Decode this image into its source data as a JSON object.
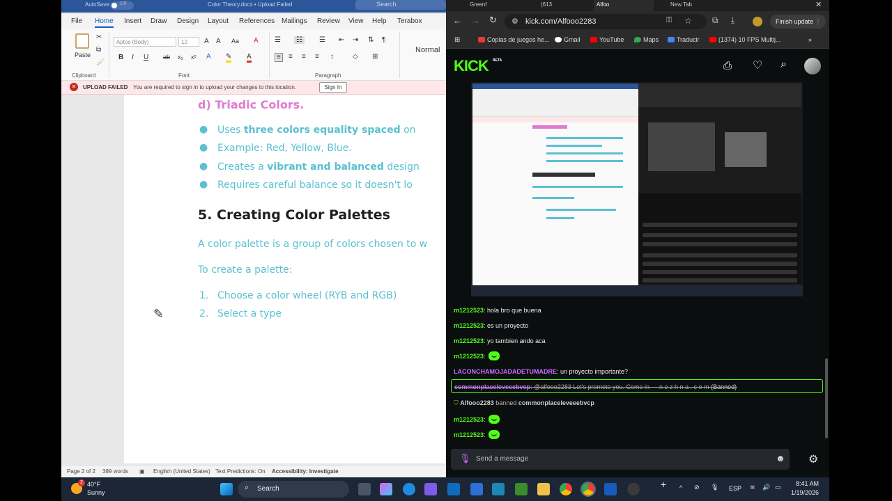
{
  "word": {
    "titlebar": {
      "autosave": "AutoSave",
      "toggle": "Off",
      "filename": "Color Theory.docx • Upload Failed",
      "search": "Search"
    },
    "tabs": [
      "File",
      "Home",
      "Insert",
      "Draw",
      "Design",
      "Layout",
      "References",
      "Mailings",
      "Review",
      "View",
      "Help",
      "Terabox"
    ],
    "active_tab": "Home",
    "ribbon": {
      "paste": "Paste",
      "clipboard": "Clipboard",
      "font_name": "Aptos (Body)",
      "font_size": "12",
      "font_group": "Font",
      "paragraph_group": "Paragraph",
      "style": "Normal"
    },
    "upload_bar": {
      "title": "UPLOAD FAILED",
      "message": "You are required to sign in to upload your changes to this location.",
      "button": "Sign In"
    },
    "document": {
      "heading_d": "d) Triadic Colors.",
      "bullets": [
        {
          "pre": "Uses ",
          "bold": "three colors equality spaced",
          "post": " on"
        },
        {
          "pre": "Example: Red, Yellow, Blue.",
          "bold": "",
          "post": ""
        },
        {
          "pre": "Creates a ",
          "bold": "vibrant and balanced",
          "post": " design"
        },
        {
          "pre": "Requires careful balance so it doesn't lo",
          "bold": "",
          "post": ""
        }
      ],
      "section_heading": "5. Creating Color Palettes",
      "para1": "A color palette is a group of colors chosen to w",
      "para2": "To create a palette:",
      "list": [
        {
          "num": "1.",
          "text": "Choose a color wheel (RYB and RGB)"
        },
        {
          "num": "2.",
          "text": "Select a type"
        }
      ]
    },
    "status": {
      "page": "Page 2 of 2",
      "words": "389 words",
      "language": "English (United States)",
      "predictions": "Text Predictions: On",
      "accessibility": "Accessibility: Investigate"
    }
  },
  "browser": {
    "tabs": [
      "Greenf",
      "(613",
      "Alfoo",
      "New Tab"
    ],
    "url": "kick.com/Alfooo2283",
    "finish_update": "Finish update",
    "bookmarks": [
      "Copias de juegos he...",
      "Gmail",
      "YouTube",
      "Maps",
      "Traducir",
      "(1374) 10 FPS Multij..."
    ],
    "kick": {
      "logo": "KICK",
      "beta": "BETA"
    }
  },
  "chat": {
    "messages": [
      {
        "user": "m1212523",
        "text": ": hola bro que buena",
        "emote": false,
        "color": "#53fc18"
      },
      {
        "user": "m1212523",
        "text": ": es un proyecto",
        "emote": false,
        "color": "#53fc18"
      },
      {
        "user": "m1212523",
        "text": ": yo tambien ando aca",
        "emote": false,
        "color": "#53fc18"
      },
      {
        "user": "m1212523",
        "text": ":",
        "emote": true,
        "color": "#53fc18"
      },
      {
        "user": "LACONCHAMOJADADETUMADRE",
        "text": ": un proyecto importante?",
        "emote": false,
        "color": "#c86bff"
      }
    ],
    "banned_msg": {
      "user": "commonplaceleveeebvcp",
      "text": ": @alfooo2283 Let's promote you. Come in — n e z h n a .  c o m",
      "tag": "(Banned)"
    },
    "ban_notice": {
      "mod": "Alfooo2283",
      "action": " banned ",
      "target": "commonplaceleveeebvcp"
    },
    "after": [
      {
        "user": "m1212523",
        "text": ":",
        "emote": true
      },
      {
        "user": "m1212523",
        "text": ":",
        "emote": true
      }
    ],
    "input_placeholder": "Send a message"
  },
  "taskbar": {
    "weather_temp": "40°F",
    "weather_desc": "Sunny",
    "weather_badge": "2",
    "search": "Search",
    "lang": "ESP",
    "time": "8:41 AM",
    "date": "1/19/2026"
  },
  "colors": {
    "kick_green": "#53fc18",
    "word_blue": "#2b579a",
    "doc_heading_pink": "#e07bd0",
    "doc_teal": "#5bc0d1"
  }
}
